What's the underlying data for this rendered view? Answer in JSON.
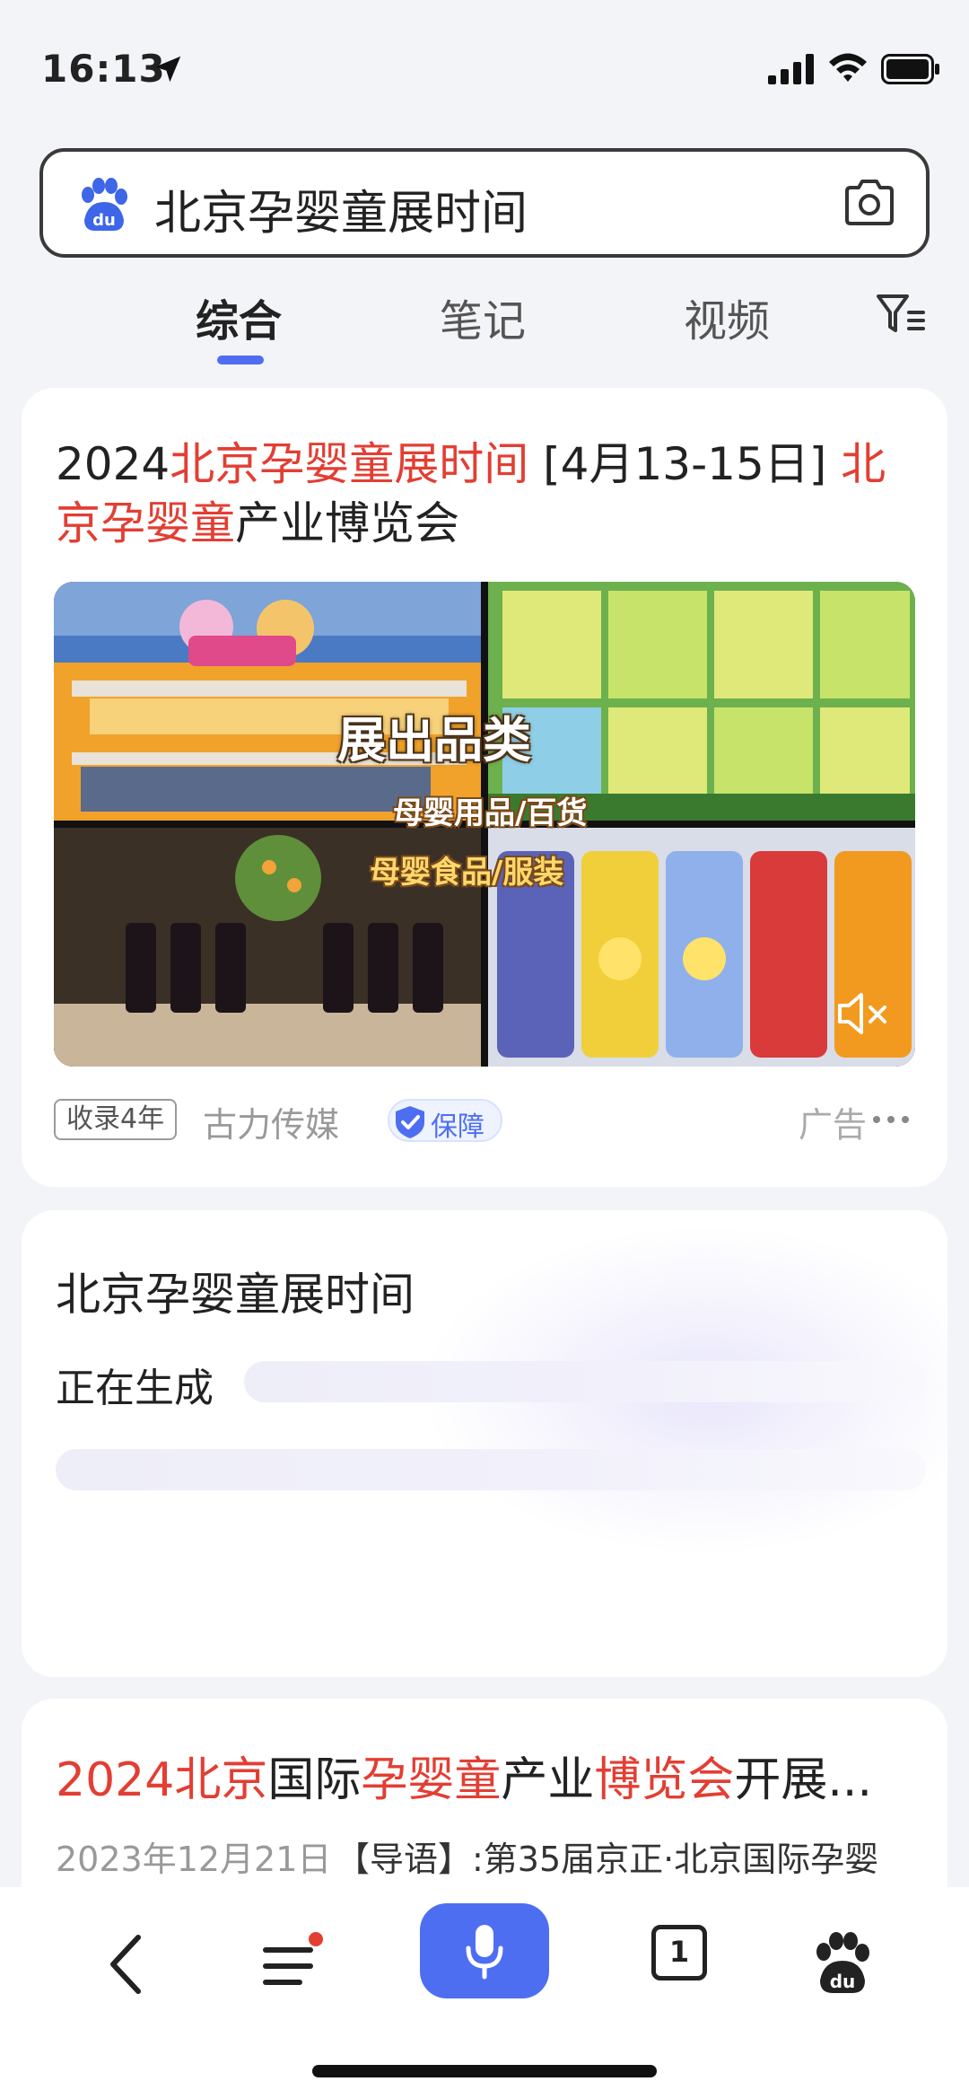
{
  "status_bar": {
    "time": "16:13",
    "icons": [
      "location-arrow-icon",
      "signal-icon",
      "wifi-icon",
      "battery-icon"
    ]
  },
  "search": {
    "query": "北京孕婴童展时间",
    "logo": "baidu-paw-icon",
    "camera": "camera-icon"
  },
  "tabs": {
    "items": [
      "综合",
      "笔记",
      "视频"
    ],
    "active": "综合",
    "filter_icon": "filter-icon",
    "accent": "#4e6ef2"
  },
  "ad_card": {
    "title_parts": [
      "2024",
      "北京孕婴童展时间",
      " [4月13-15日] ",
      "北京孕婴童",
      "产业博览会"
    ],
    "highlight_color": "#e33e33",
    "media_labels": {
      "main": "展出品类",
      "sub1": "母婴用品/百货",
      "sub2": "母婴食品/服装"
    },
    "badge_years": "收录4年",
    "source": "古力传媒",
    "guarantee": "保障",
    "ad_label": "广告"
  },
  "ai_card": {
    "title": "北京孕婴童展时间",
    "status": "正在生成"
  },
  "result_card": {
    "title_parts": [
      "2024北京",
      "国际",
      "孕婴童",
      "产业",
      "博览会",
      "开展..."
    ],
    "date": "2023年12月21日",
    "snippet": "【导语】:第35届京正·北京国际孕婴"
  },
  "bottom_bar": {
    "tabs_count": "1",
    "icons": [
      "back-icon",
      "menu-icon",
      "microphone-icon",
      "tabs-icon",
      "baidu-home-icon"
    ],
    "notification_dot_color": "#e33e33"
  }
}
